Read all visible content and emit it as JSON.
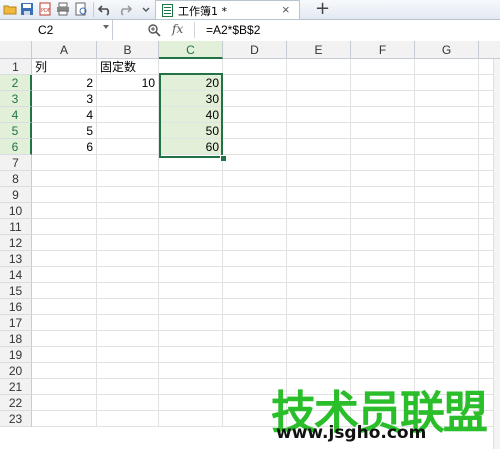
{
  "toolbar": {
    "icons": [
      "open-folder-icon",
      "save-icon",
      "pdf-icon",
      "print-icon",
      "print-preview-icon",
      "undo-icon",
      "redo-icon",
      "more-icon"
    ],
    "tab_title": "工作簿1 *",
    "tab_close": "×",
    "new_tab": "+"
  },
  "formula_bar": {
    "name_box": "C2",
    "fx_label": "fx",
    "formula": "=A2*$B$2"
  },
  "columns": [
    "A",
    "B",
    "C",
    "D",
    "E",
    "F",
    "G"
  ],
  "selected_column": "C",
  "rows": [
    "1",
    "2",
    "3",
    "4",
    "5",
    "6",
    "7",
    "8",
    "9",
    "10",
    "11",
    "12",
    "13",
    "14",
    "15",
    "16",
    "17",
    "18",
    "19",
    "20",
    "21",
    "22",
    "23"
  ],
  "selected_rows": [
    "2",
    "3",
    "4",
    "5",
    "6"
  ],
  "cells": {
    "A1": "列",
    "B1": "固定数",
    "A2": "2",
    "B2": "10",
    "C2": "20",
    "A3": "3",
    "C3": "30",
    "A4": "4",
    "C4": "40",
    "A5": "5",
    "C5": "50",
    "A6": "6",
    "C6": "60"
  },
  "watermark": {
    "text": "技术员联盟",
    "url": "www.jsgho.com",
    "color": "#14b814"
  },
  "colors": {
    "selection": "#217346",
    "selection_fill": "#e2efd9"
  }
}
